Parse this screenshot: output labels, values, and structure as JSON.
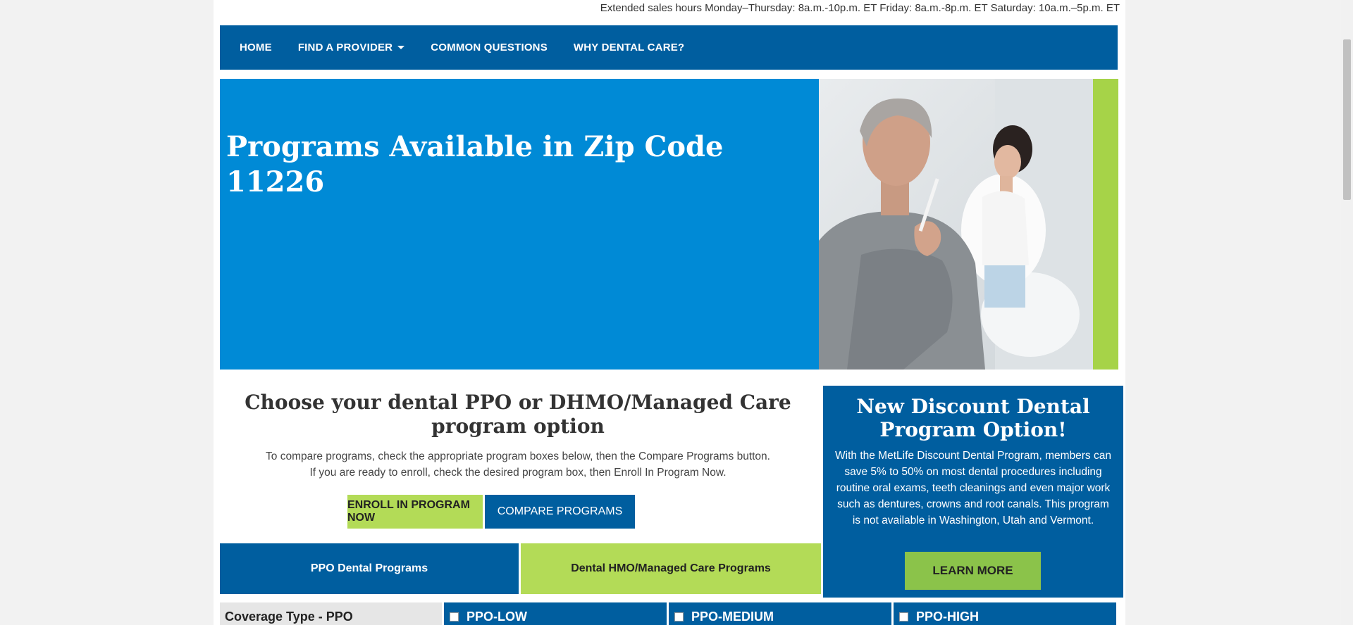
{
  "header": {
    "sales_hours": "Extended sales hours Monday–Thursday: 8a.m.-10p.m. ET Friday: 8a.m.-8p.m. ET Saturday: 10a.m.–5p.m. ET"
  },
  "nav": {
    "items": [
      {
        "label": "HOME"
      },
      {
        "label": "FIND A PROVIDER",
        "has_dropdown": true
      },
      {
        "label": "COMMON QUESTIONS"
      },
      {
        "label": "WHY DENTAL CARE?"
      }
    ]
  },
  "hero": {
    "title": "Programs Available in Zip Code 11226"
  },
  "choose": {
    "heading": "Choose your dental PPO or DHMO/Managed Care program option",
    "line1": "To compare programs, check the appropriate program boxes below, then the Compare Programs button.",
    "line2": "If you are ready to enroll, check the desired program box, then Enroll In Program Now.",
    "enroll_label": "ENROLL IN PROGRAM NOW",
    "compare_label": "COMPARE PROGRAMS"
  },
  "tabs": {
    "ppo": "PPO Dental Programs",
    "dhmo": "Dental HMO/Managed Care Programs"
  },
  "promo": {
    "heading": "New Discount Dental Program Option!",
    "body": "With the MetLife Discount Dental Program, members can save 5% to 50% on most dental procedures including routine oral exams, teeth cleanings and even major work such as dentures, crowns and root canals. This program is not available in Washington, Utah and Vermont.",
    "button": "LEARN MORE"
  },
  "coverage": {
    "label": "Coverage Type - PPO",
    "columns": [
      "PPO-LOW",
      "PPO-MEDIUM",
      "PPO-HIGH"
    ]
  },
  "colors": {
    "brand_blue": "#005e9f",
    "hero_blue": "#008ad6",
    "accent_green": "#b3db57"
  }
}
